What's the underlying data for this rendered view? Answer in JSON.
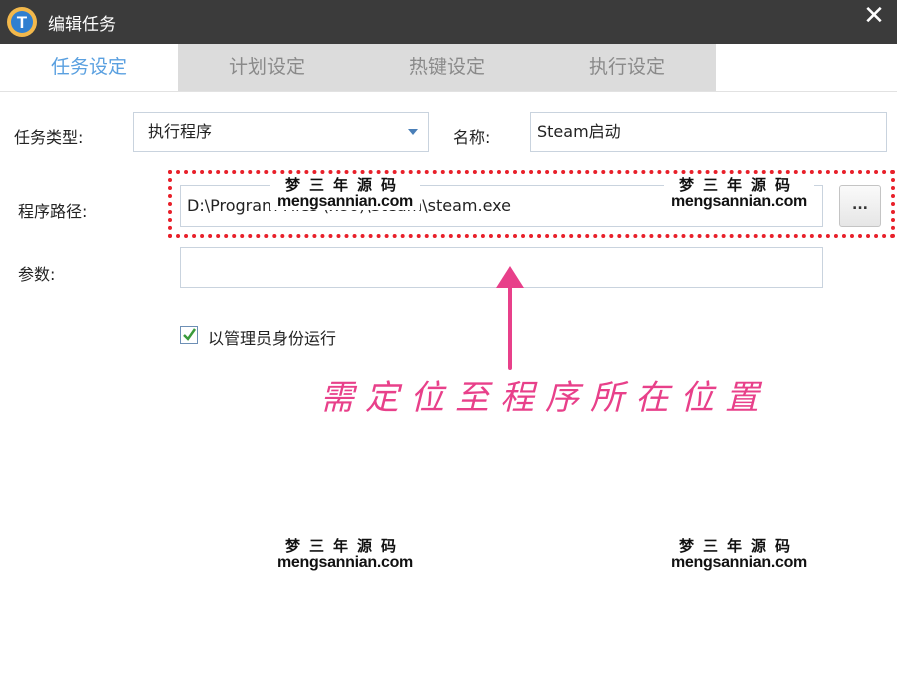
{
  "window": {
    "title": "编辑任务",
    "app_icon_letter": "T",
    "close_glyph": "✕"
  },
  "tabs": [
    {
      "label": "任务设定",
      "active": true
    },
    {
      "label": "计划设定",
      "active": false
    },
    {
      "label": "热键设定",
      "active": false
    },
    {
      "label": "执行设定",
      "active": false
    }
  ],
  "form": {
    "task_type_label": "任务类型:",
    "task_type_value": "执行程序",
    "name_label": "名称:",
    "name_value": "Steam启动",
    "path_label": "程序路径:",
    "path_value": "D:\\Program Files (x86)\\Steam\\steam.exe",
    "browse_label": "...",
    "params_label": "参数:",
    "params_value": "",
    "run_as_admin_label": "以管理员身份运行",
    "run_as_admin_checked": true
  },
  "annotation": {
    "text": "需定位至程序所在位置",
    "color": "#e8408a",
    "highlight_color": "#e8202a"
  },
  "watermarks": [
    {
      "cn": "梦三年源码",
      "en": "mengsannian.com"
    },
    {
      "cn": "梦三年源码",
      "en": "mengsannian.com"
    },
    {
      "cn": "梦三年源码",
      "en": "mengsannian.com"
    },
    {
      "cn": "梦三年源码",
      "en": "mengsannian.com"
    }
  ],
  "colors": {
    "titlebar": "#3b3b3b",
    "tab_active_text": "#5aa0e0",
    "tab_inactive_bg": "#dcdcdc",
    "checkbox_check": "#3a9a3a"
  }
}
